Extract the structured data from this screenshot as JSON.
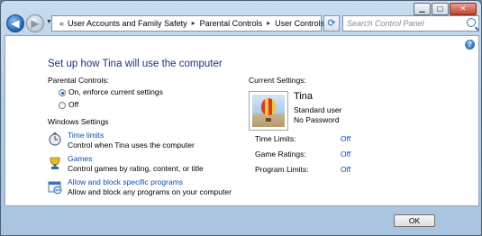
{
  "window": {
    "controls": {
      "minimize": "▁",
      "maximize": "▢",
      "close": "✕"
    }
  },
  "nav": {
    "back_icon": "arrow-left-icon",
    "forward_icon": "arrow-right-icon",
    "breadcrumbs": [
      "User Accounts and Family Safety",
      "Parental Controls",
      "User Controls"
    ],
    "chevron": "«",
    "separator": "▸",
    "search_placeholder": "Search Control Panel"
  },
  "main": {
    "heading": "Set up how Tina will use the computer",
    "parental_controls": {
      "label": "Parental Controls:",
      "options": [
        {
          "label": "On, enforce current settings",
          "selected": true
        },
        {
          "label": "Off",
          "selected": false
        }
      ]
    },
    "windows_settings": {
      "label": "Windows Settings",
      "items": [
        {
          "title": "Time limits",
          "description": "Control when Tina uses the computer",
          "icon": "stopwatch-icon"
        },
        {
          "title": "Games",
          "description": "Control games by rating, content, or title",
          "icon": "games-icon"
        },
        {
          "title": "Allow and block specific programs",
          "description": "Allow and block any programs on your computer",
          "icon": "programs-icon"
        }
      ]
    },
    "current_settings": {
      "label": "Current Settings:",
      "user_name": "Tina",
      "account_type": "Standard user",
      "password_status": "No Password",
      "rows": [
        {
          "label": "Time Limits:",
          "value": "Off"
        },
        {
          "label": "Game Ratings:",
          "value": "Off"
        },
        {
          "label": "Program Limits:",
          "value": "Off"
        }
      ]
    }
  },
  "footer": {
    "ok_label": "OK"
  },
  "colors": {
    "heading": "#1e3287",
    "link": "#0b4fb8",
    "frame": "#b3cce6"
  }
}
